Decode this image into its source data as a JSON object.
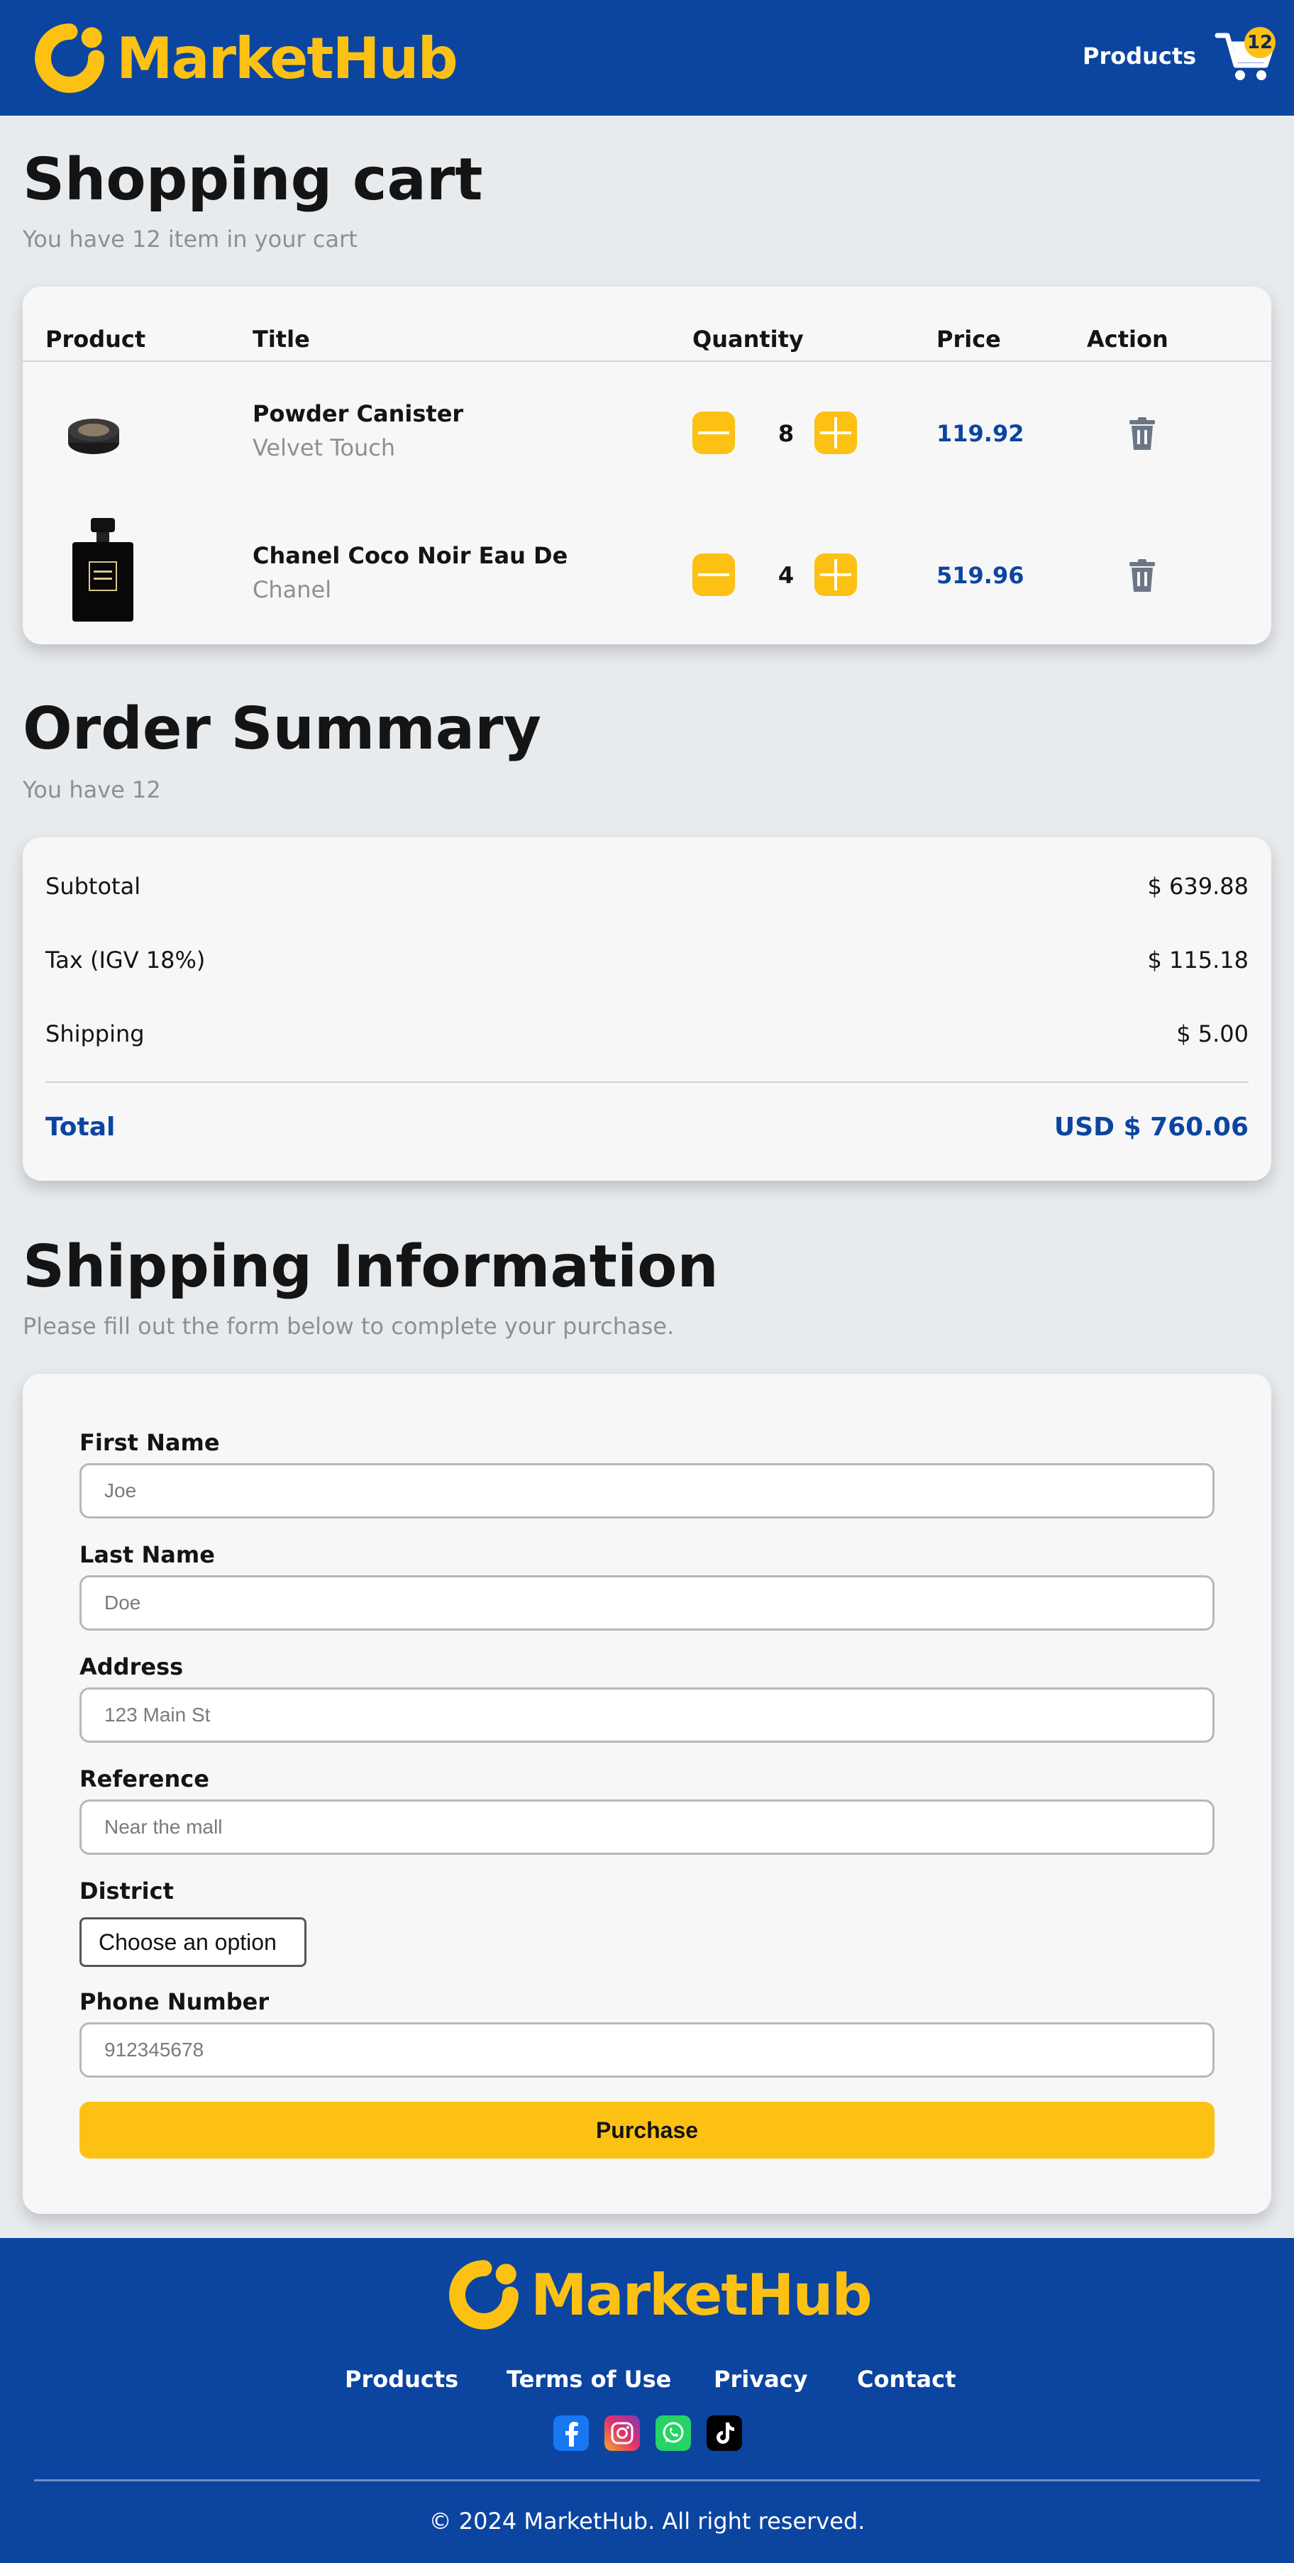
{
  "header": {
    "brand": "MarketHub",
    "nav_products": "Products",
    "cart_count": "12"
  },
  "cart": {
    "title": "Shopping cart",
    "subtitle": "You have 12 item in your cart",
    "columns": [
      "Product",
      "Title",
      "Quantity",
      "Price",
      "Action"
    ],
    "items": [
      {
        "name": "Powder Canister",
        "brand": "Velvet Touch",
        "quantity": "8",
        "price": "119.92"
      },
      {
        "name": "Chanel Coco Noir Eau De",
        "brand": "Chanel",
        "quantity": "4",
        "price": "519.96"
      }
    ]
  },
  "summary": {
    "title": "Order Summary",
    "subtitle": "You have 12",
    "rows": [
      {
        "label": "Subtotal",
        "value": "$ 639.88"
      },
      {
        "label": "Tax (IGV 18%)",
        "value": "$ 115.18"
      },
      {
        "label": "Shipping",
        "value": "$ 5.00"
      }
    ],
    "total_label": "Total",
    "total_value": "USD $ 760.06"
  },
  "shipping": {
    "title": "Shipping Information",
    "subtitle": "Please fill out the form below to complete your purchase.",
    "fields": {
      "first_name": {
        "label": "First Name",
        "placeholder": "Joe"
      },
      "last_name": {
        "label": "Last Name",
        "placeholder": "Doe"
      },
      "address": {
        "label": "Address",
        "placeholder": "123 Main St"
      },
      "reference": {
        "label": "Reference",
        "placeholder": "Near the mall"
      },
      "district": {
        "label": "District",
        "selected": "Choose an option"
      },
      "phone": {
        "label": "Phone Number",
        "placeholder": "912345678"
      }
    },
    "purchase_label": "Purchase"
  },
  "footer": {
    "brand": "MarketHub",
    "links": [
      "Products",
      "Terms of Use",
      "Privacy",
      "Contact"
    ],
    "social_icons": [
      "facebook-icon",
      "instagram-icon",
      "whatsapp-icon",
      "tiktok-icon"
    ],
    "copyright": "© 2024 MarketHub. All right reserved."
  },
  "colors": {
    "primary": "#0c45a0",
    "accent": "#fdc114",
    "background": "#e8ebee",
    "card": "#f7f7f7"
  }
}
